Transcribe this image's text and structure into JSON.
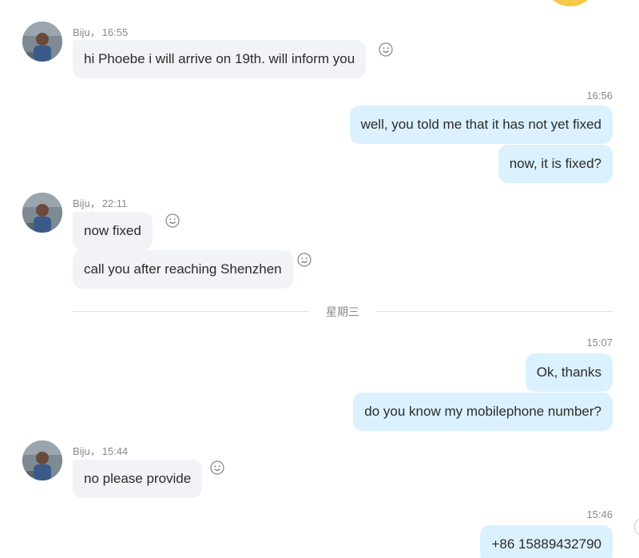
{
  "conversation": {
    "contact_name": "Biju",
    "separator": "，",
    "incoming": [
      {
        "time": "16:55",
        "messages": [
          "hi Phoebe i will arrive on 19th. will inform you"
        ]
      },
      {
        "time": "22:11",
        "messages": [
          "now fixed",
          "call you after reaching Shenzhen"
        ]
      },
      {
        "time": "15:44",
        "messages": [
          "no please provide"
        ]
      }
    ],
    "outgoing": [
      {
        "time": "16:56",
        "messages": [
          "well, you told me that it has not yet fixed",
          "now, it is fixed?"
        ]
      },
      {
        "time": "15:07",
        "messages": [
          "Ok, thanks",
          "do you know my mobilephone number?"
        ]
      },
      {
        "time": "15:46",
        "messages": [
          "+86 15889432790"
        ]
      }
    ],
    "day_divider": "星期三"
  },
  "icons": {
    "avatar": "avatar-photo",
    "reaction": "smiley-icon"
  },
  "colors": {
    "incoming_bubble": "#f1f3f7",
    "outgoing_bubble": "#dbf1fd",
    "meta_text": "#8a8a8a",
    "message_text": "#2b2b2b"
  }
}
